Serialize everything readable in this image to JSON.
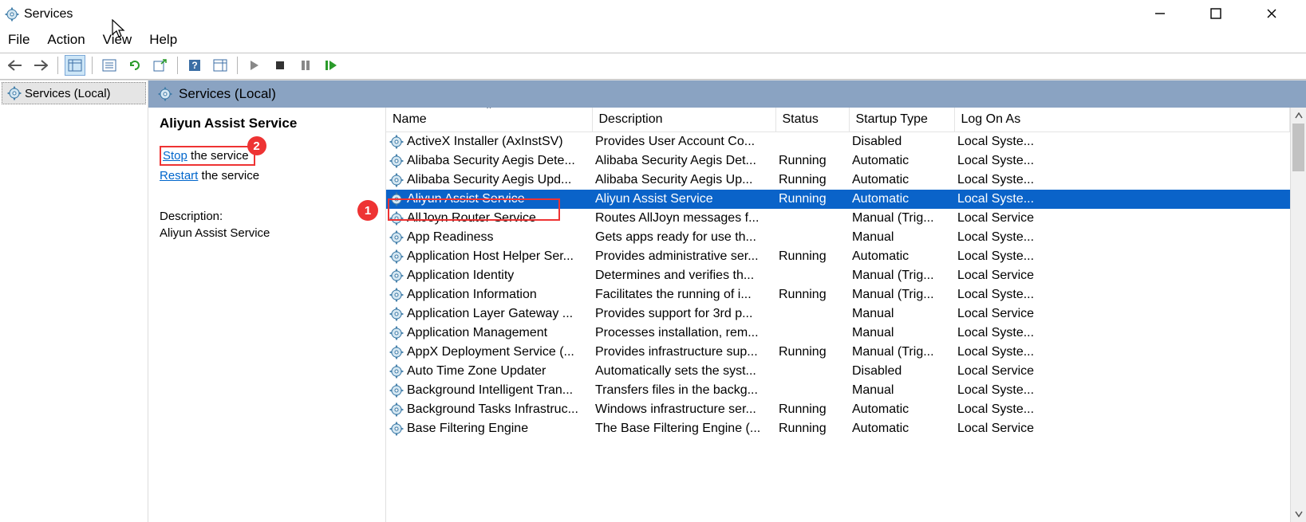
{
  "window": {
    "title": "Services"
  },
  "menu": {
    "file": "File",
    "action": "Action",
    "view": "View",
    "help": "Help"
  },
  "tree": {
    "root": "Services (Local)"
  },
  "pane": {
    "header": "Services (Local)"
  },
  "detail": {
    "selected_name": "Aliyun Assist Service",
    "stop_link": "Stop",
    "stop_suffix": " the service",
    "restart_link": "Restart",
    "restart_suffix": " the service",
    "desc_label": "Description:",
    "desc_value": "Aliyun Assist Service"
  },
  "annotations": {
    "one": "1",
    "two": "2"
  },
  "columns": {
    "name": "Name",
    "description": "Description",
    "status": "Status",
    "startup": "Startup Type",
    "logon": "Log On As"
  },
  "services": [
    {
      "name": "ActiveX Installer (AxInstSV)",
      "desc": "Provides User Account Co...",
      "status": "",
      "startup": "Disabled",
      "logon": "Local Syste..."
    },
    {
      "name": "Alibaba Security Aegis Dete...",
      "desc": "Alibaba Security Aegis Det...",
      "status": "Running",
      "startup": "Automatic",
      "logon": "Local Syste..."
    },
    {
      "name": "Alibaba Security Aegis Upd...",
      "desc": "Alibaba Security Aegis Up...",
      "status": "Running",
      "startup": "Automatic",
      "logon": "Local Syste..."
    },
    {
      "name": "Aliyun Assist Service",
      "desc": "Aliyun Assist Service",
      "status": "Running",
      "startup": "Automatic",
      "logon": "Local Syste...",
      "selected": true
    },
    {
      "name": "AllJoyn Router Service",
      "desc": "Routes AllJoyn messages f...",
      "status": "",
      "startup": "Manual (Trig...",
      "logon": "Local Service"
    },
    {
      "name": "App Readiness",
      "desc": "Gets apps ready for use th...",
      "status": "",
      "startup": "Manual",
      "logon": "Local Syste..."
    },
    {
      "name": "Application Host Helper Ser...",
      "desc": "Provides administrative ser...",
      "status": "Running",
      "startup": "Automatic",
      "logon": "Local Syste..."
    },
    {
      "name": "Application Identity",
      "desc": "Determines and verifies th...",
      "status": "",
      "startup": "Manual (Trig...",
      "logon": "Local Service"
    },
    {
      "name": "Application Information",
      "desc": "Facilitates the running of i...",
      "status": "Running",
      "startup": "Manual (Trig...",
      "logon": "Local Syste..."
    },
    {
      "name": "Application Layer Gateway ...",
      "desc": "Provides support for 3rd p...",
      "status": "",
      "startup": "Manual",
      "logon": "Local Service"
    },
    {
      "name": "Application Management",
      "desc": "Processes installation, rem...",
      "status": "",
      "startup": "Manual",
      "logon": "Local Syste..."
    },
    {
      "name": "AppX Deployment Service (...",
      "desc": "Provides infrastructure sup...",
      "status": "Running",
      "startup": "Manual (Trig...",
      "logon": "Local Syste..."
    },
    {
      "name": "Auto Time Zone Updater",
      "desc": "Automatically sets the syst...",
      "status": "",
      "startup": "Disabled",
      "logon": "Local Service"
    },
    {
      "name": "Background Intelligent Tran...",
      "desc": "Transfers files in the backg...",
      "status": "",
      "startup": "Manual",
      "logon": "Local Syste..."
    },
    {
      "name": "Background Tasks Infrastruc...",
      "desc": "Windows infrastructure ser...",
      "status": "Running",
      "startup": "Automatic",
      "logon": "Local Syste..."
    },
    {
      "name": "Base Filtering Engine",
      "desc": "The Base Filtering Engine (...",
      "status": "Running",
      "startup": "Automatic",
      "logon": "Local Service"
    }
  ]
}
